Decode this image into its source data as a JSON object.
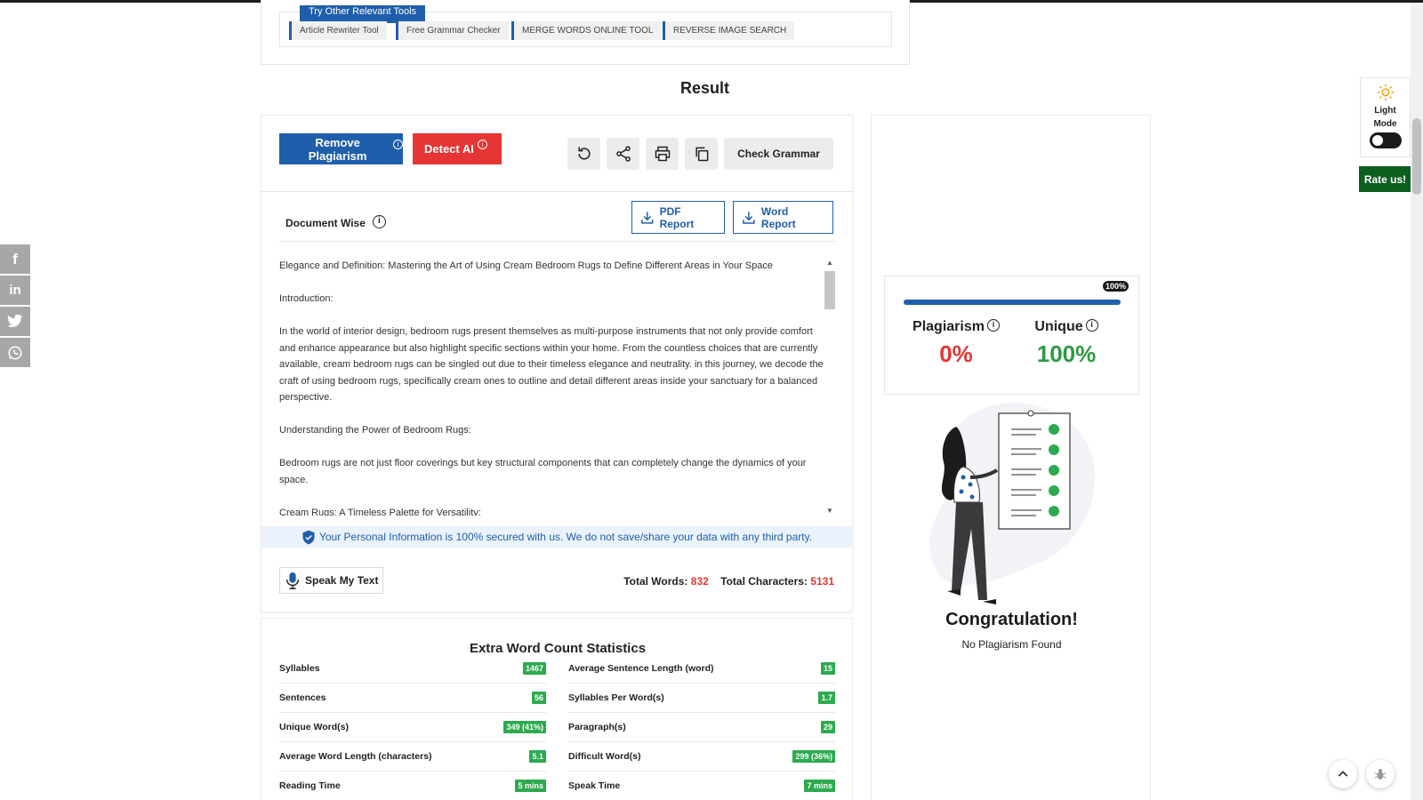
{
  "tools": {
    "tab_label": "Try Other Relevant Tools",
    "chips": [
      "Article Rewriter Tool",
      "Free Grammar Checker",
      "MERGE WORDS ONLINE TOOL",
      "REVERSE IMAGE SEARCH"
    ]
  },
  "result_heading": "Result",
  "toolbar": {
    "remove_plagiarism": "Remove Plagiarism",
    "detect_ai": "Detect AI",
    "info_glyph": "i",
    "check_grammar": "Check Grammar"
  },
  "document": {
    "label": "Document Wise",
    "pdf_report": "PDF Report",
    "word_report": "Word Report",
    "paragraphs": [
      "Elegance and Definition: Mastering the Art of Using Cream Bedroom Rugs to Define Different Areas in Your Space",
      "Introduction:",
      "In the world of interior design, bedroom rugs present themselves as multi-purpose instruments that not only provide comfort and enhance appearance but also highlight specific sections within your home. From the countless choices that are currently available, cream bedroom rugs can be singled out due to their timeless elegance and neutrality. in this journey, we decode the craft of using bedroom rugs, specifically cream ones to outline and detail different areas inside your sanctuary for a balanced perspective.",
      "Understanding the Power of Bedroom Rugs:",
      "Bedroom rugs are not just floor coverings but key structural components that can completely change the dynamics of your space.",
      "Cream Rugs: A Timeless Palette for Versatility:"
    ]
  },
  "secure_notice": "Your Personal Information is 100% secured with us. We do not save/share your data with any third party.",
  "speak_label": "Speak My Text",
  "totals": {
    "words_label": "Total Words:",
    "words_value": "832",
    "chars_label": "Total Characters:",
    "chars_value": "5131"
  },
  "stats": {
    "title": "Extra Word Count Statistics",
    "left": [
      {
        "label": "Syllables",
        "value": "1467"
      },
      {
        "label": "Sentences",
        "value": "56"
      },
      {
        "label": "Unique Word(s)",
        "value": "349 (41%)"
      },
      {
        "label": "Average Word Length (characters)",
        "value": "5.1"
      },
      {
        "label": "Reading Time",
        "value": "5 mins"
      }
    ],
    "right": [
      {
        "label": "Average Sentence Length (word)",
        "value": "15"
      },
      {
        "label": "Syllables Per Word(s)",
        "value": "1.7"
      },
      {
        "label": "Paragraph(s)",
        "value": "29"
      },
      {
        "label": "Difficult Word(s)",
        "value": "299 (36%)"
      },
      {
        "label": "Speak Time",
        "value": "7 mins"
      }
    ]
  },
  "score": {
    "progress_tag": "100%",
    "progress_fraction": 1.0,
    "plagiarism_label": "Plagiarism",
    "plagiarism_value": "0%",
    "unique_label": "Unique",
    "unique_value": "100%",
    "congrats": "Congratulation!",
    "subtitle": "No Plagiarism Found"
  },
  "light_mode": {
    "line1": "Light",
    "line2": "Mode"
  },
  "rate_us": "Rate us!",
  "social": [
    "facebook-icon",
    "linkedin-icon",
    "twitter-icon",
    "whatsapp-icon"
  ],
  "colors": {
    "primary": "#1f5eab",
    "danger": "#e53534",
    "success": "#2daa4f",
    "rate": "#0e5f1f"
  }
}
